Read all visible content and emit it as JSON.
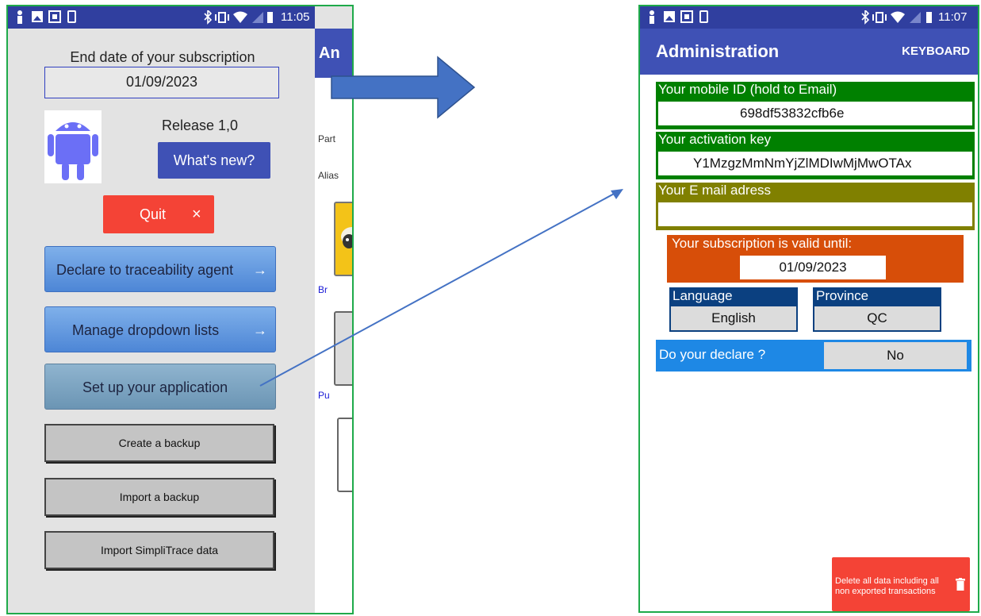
{
  "left_screen": {
    "status_time": "11:05",
    "subscription_label": "End date of your subscription",
    "subscription_date": "01/09/2023",
    "release_label": "Release 1,0",
    "whats_new_button": "What's new?",
    "quit_button": "Quit",
    "quit_icon": "×",
    "nav_buttons": [
      {
        "label": "Declare to traceability agent",
        "arrow": "→"
      },
      {
        "label": "Manage dropdown lists",
        "arrow": "→"
      },
      {
        "label": "Set up your application"
      }
    ],
    "backup_buttons": [
      "Create a backup",
      "Import a backup",
      "Import SimpliTrace data"
    ],
    "partial_background": {
      "appbar_title": "An",
      "text_1": "Part",
      "text_2": "Alias",
      "link_1": "Br",
      "link_2": "Pu"
    }
  },
  "right_screen": {
    "status_time": "11:07",
    "title": "Administration",
    "keyboard_action": "KEYBOARD",
    "mobile_id": {
      "label": "Your mobile ID (hold to Email)",
      "value": "698df53832cfb6e"
    },
    "activation_key": {
      "label": "Your activation key",
      "value": "Y1MzgzMmNmYjZlMDIwMjMwOTAx"
    },
    "email": {
      "label": "Your E mail adress",
      "value": ""
    },
    "subscription": {
      "label": "Your subscription is valid until:",
      "value": "01/09/2023"
    },
    "language": {
      "label": "Language",
      "value": "English"
    },
    "province": {
      "label": "Province",
      "value": "QC"
    },
    "declare": {
      "label": "Do your declare ?",
      "value": "No"
    },
    "delete_button": "Delete all data including all non exported transactions"
  },
  "colors": {
    "app_primary": "#3f51b5",
    "status_bar": "#303f9f",
    "mobile_id_box": "#008000",
    "email_box": "#808000",
    "subscription_box": "#d74e09",
    "select_box": "#0b4080",
    "declare_row": "#1e88e5",
    "danger": "#f44336",
    "frame": "#1faa4a"
  },
  "icons": [
    "person-icon",
    "image-icon",
    "screenshot-icon",
    "phone-icon",
    "bluetooth-icon",
    "vibrate-icon",
    "wifi-icon",
    "signal-icon",
    "battery-icon",
    "android-robot-icon",
    "close-icon",
    "arrow-right-icon",
    "trash-icon"
  ]
}
